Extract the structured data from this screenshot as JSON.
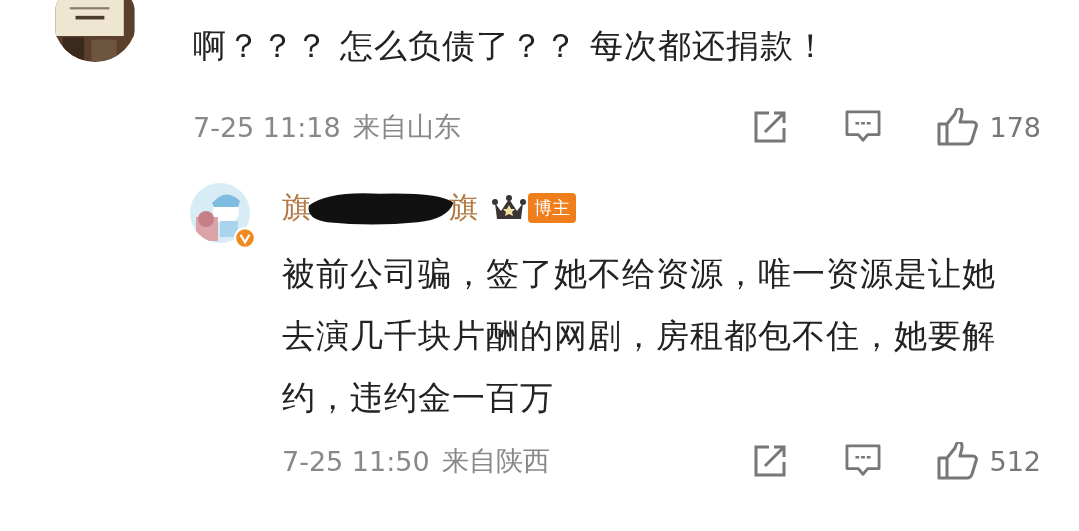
{
  "comment": {
    "text": "啊？？？ 怎么负债了？？ 每次都还捐款！",
    "date": "7-25 11:18",
    "location": "来自山东",
    "likes": "178"
  },
  "reply": {
    "username_start": "旗",
    "username_end": "旗",
    "verified": true,
    "badge": "博主",
    "text": "被前公司骗，签了她不给资源，唯一资源是让她去演几千块片酬的网剧，房租都包不住，她要解约，违约金一百万",
    "date": "7-25 11:50",
    "location": "来自陕西",
    "likes": "512"
  }
}
